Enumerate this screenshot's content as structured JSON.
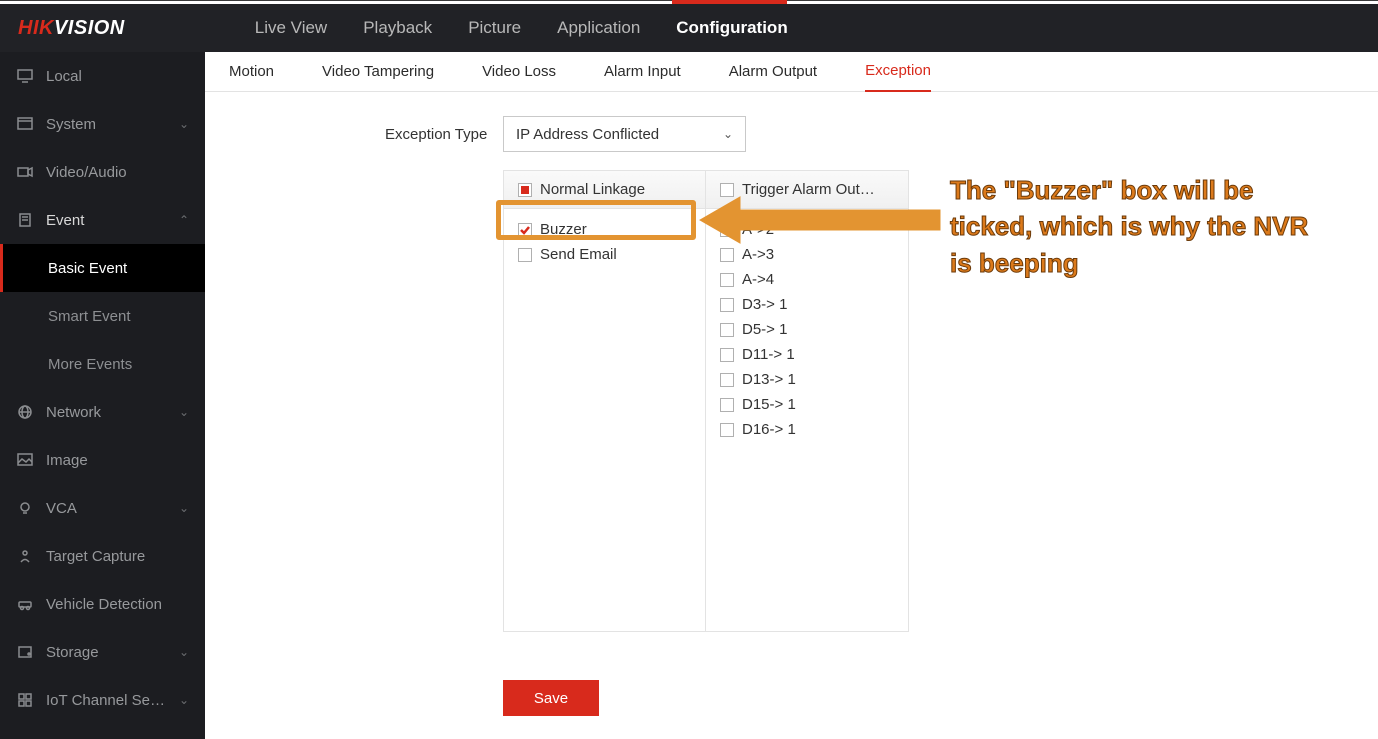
{
  "logo": {
    "part1": "HIK",
    "part2": "VISION"
  },
  "topnav": {
    "live_view": "Live View",
    "playback": "Playback",
    "picture": "Picture",
    "application": "Application",
    "configuration": "Configuration"
  },
  "sidebar": {
    "local": "Local",
    "system": "System",
    "video_audio": "Video/Audio",
    "event": "Event",
    "basic_event": "Basic Event",
    "smart_event": "Smart Event",
    "more_events": "More Events",
    "network": "Network",
    "image": "Image",
    "vca": "VCA",
    "target_capture": "Target Capture",
    "vehicle_detection": "Vehicle Detection",
    "storage": "Storage",
    "iot_channel": "IoT Channel Se…"
  },
  "subtabs": {
    "motion": "Motion",
    "video_tampering": "Video Tampering",
    "video_loss": "Video Loss",
    "alarm_input": "Alarm Input",
    "alarm_output": "Alarm Output",
    "exception": "Exception"
  },
  "form": {
    "exception_type_label": "Exception Type",
    "exception_type_value": "IP Address Conflicted"
  },
  "linkage": {
    "normal_header": "Normal Linkage",
    "buzzer": "Buzzer",
    "send_email": "Send Email",
    "trigger_header": "Trigger Alarm Out…",
    "outputs": [
      "A->2",
      "A->3",
      "A->4",
      "D3-> 1",
      "D5-> 1",
      "D11-> 1",
      "D13-> 1",
      "D15-> 1",
      "D16-> 1"
    ]
  },
  "save_label": "Save",
  "annotation": "The \"Buzzer\" box will be ticked, which is why the NVR is beeping"
}
